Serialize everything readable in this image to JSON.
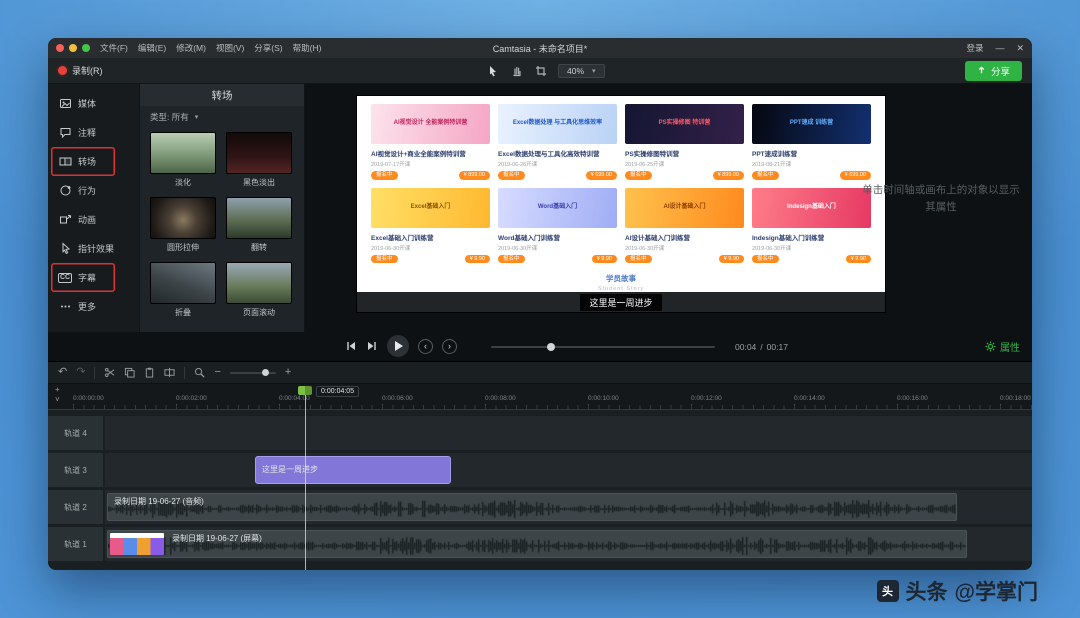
{
  "titlebar": {
    "title": "Camtasia - 未命名项目*",
    "menus": [
      "文件(F)",
      "编辑(E)",
      "修改(M)",
      "视图(V)",
      "分享(S)",
      "帮助(H)"
    ],
    "login_label": "登录",
    "minimize": "—",
    "close": "✕"
  },
  "toolbar": {
    "record_label": "录制(R)",
    "zoom_value": "40%",
    "share_label": "分享"
  },
  "sidebar": {
    "items": [
      {
        "label": "媒体"
      },
      {
        "label": "注释"
      },
      {
        "label": "转场",
        "highlighted": true
      },
      {
        "label": "行为"
      },
      {
        "label": "动画"
      },
      {
        "label": "指针效果"
      },
      {
        "label": "字幕",
        "highlighted": true
      },
      {
        "label": "更多"
      }
    ]
  },
  "transitions_panel": {
    "title": "转场",
    "filter": "类型: 所有",
    "items": [
      {
        "name": "淡化"
      },
      {
        "name": "黑色淡出"
      },
      {
        "name": "圆形拉伸"
      },
      {
        "name": "翻转"
      },
      {
        "name": "折叠"
      },
      {
        "name": "页面滚动"
      }
    ]
  },
  "preview": {
    "hint": "单击时间轴或画布上的对象以显示其属性",
    "caption": "这里是一周进步",
    "section_title": "学员故事",
    "section_subtitle": "Student Story",
    "cards": [
      {
        "banner": "AI视觉设计 全能案例特训营",
        "title": "AI视觉设计+商业全能案例特训营",
        "date": "2019-07-17开课",
        "tag": "报名中",
        "price": "¥ 899.00"
      },
      {
        "banner": "Excel数据处理 与工具化思维效率",
        "title": "Excel数据处理与工具化高效特训营",
        "date": "2019-06-26开课",
        "tag": "报名中",
        "price": "¥ 699.00"
      },
      {
        "banner": "PS实操修图 特训营",
        "title": "PS实操修图特训营",
        "date": "2019-06-25开课",
        "tag": "报名中",
        "price": "¥ 899.00"
      },
      {
        "banner": "PPT速成 训练营",
        "title": "PPT速成训练营",
        "date": "2019-08-21开课",
        "tag": "报名中",
        "price": "¥ 699.00"
      },
      {
        "banner": "Excel基础入门",
        "title": "Excel基础入门训练营",
        "date": "2019-06-30开课",
        "tag": "报名中",
        "price": "¥ 9.90"
      },
      {
        "banner": "Word基础入门",
        "title": "Word基础入门训练营",
        "date": "2019-06-30开课",
        "tag": "报名中",
        "price": "¥ 9.90"
      },
      {
        "banner": "AI设计基础入门",
        "title": "AI设计基础入门训练营",
        "date": "2019-06-30开课",
        "tag": "报名中",
        "price": "¥ 9.90"
      },
      {
        "banner": "Indesign基础入门",
        "title": "Indesign基础入门训练营",
        "date": "2019-06-30开课",
        "tag": "报名中",
        "price": "¥ 9.90"
      }
    ]
  },
  "playback": {
    "current_time": "00:04",
    "separator": "/",
    "total_time": "00:17",
    "properties_label": "属性"
  },
  "timeline": {
    "playhead_time": "0:00:04:05",
    "ticks": [
      "0:00:00:00",
      "0:00:02:00",
      "0:00:04:00",
      "0:00:06:00",
      "0:00:08:00",
      "0:00:10:00",
      "0:00:12:00",
      "0:00:14:00",
      "0:00:16:00",
      "0:00:18:00"
    ],
    "tracks": [
      {
        "name": "轨道 4"
      },
      {
        "name": "轨道 3",
        "clip_label": "这里是一周进步"
      },
      {
        "name": "轨道 2",
        "clip_label": "录制日期 19-06-27 (音频)"
      },
      {
        "name": "轨道 1",
        "clip_label": "录制日期 19-06-27 (屏幕)"
      }
    ]
  },
  "watermark": {
    "brand": "头条",
    "handle": "@学掌门"
  },
  "colors": {
    "accent_green": "#2fb344",
    "record_red": "#e8413c",
    "clip_purple": "#8276d8",
    "badge_orange": "#ff8a1e",
    "highlight_red": "#e03131"
  }
}
